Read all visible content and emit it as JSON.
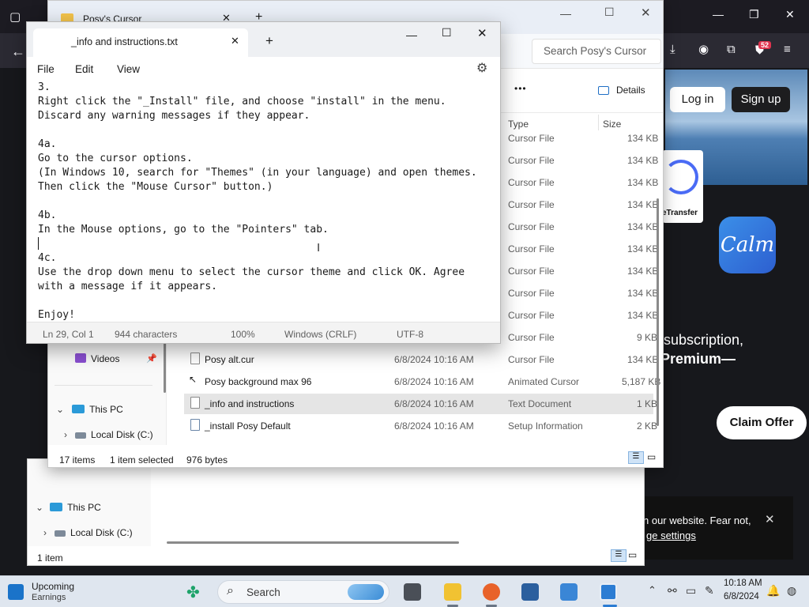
{
  "browser": {
    "explorer_tab_title": "Posy's Cursor",
    "new_tab": "+",
    "notif_count": "52",
    "login": "Log in",
    "signup": "Sign up",
    "wetransfer": "eTransfer",
    "calm": "Calm",
    "promo_line1": "subscription,",
    "promo_line2": "Premium—",
    "claim": "Claim Offer",
    "cookie_text": "n our website. Fear not,",
    "cookie_link": "ge settings",
    "cookie_close": "✕"
  },
  "explorer": {
    "search_placeholder": "Search Posy's Cursor",
    "more": "•••",
    "details": "Details",
    "columns": {
      "type": "Type",
      "size": "Size"
    },
    "upper_rows": [
      {
        "type": "Cursor File",
        "size": "134 KB"
      },
      {
        "type": "Cursor File",
        "size": "134 KB"
      },
      {
        "type": "Cursor File",
        "size": "134 KB"
      },
      {
        "type": "Cursor File",
        "size": "134 KB"
      },
      {
        "type": "Cursor File",
        "size": "134 KB"
      },
      {
        "type": "Cursor File",
        "size": "134 KB"
      },
      {
        "type": "Cursor File",
        "size": "134 KB"
      },
      {
        "type": "Cursor File",
        "size": "134 KB"
      },
      {
        "type": "Cursor File",
        "size": "134 KB"
      },
      {
        "type": "Cursor File",
        "size": "9 KB"
      }
    ],
    "files": [
      {
        "name": "Posy alt.cur",
        "date": "6/8/2024 10:16 AM",
        "type": "Cursor File",
        "size": "134 KB"
      },
      {
        "name": "Posy background max 96",
        "date": "6/8/2024 10:16 AM",
        "type": "Animated Cursor",
        "size": "5,187 KB"
      },
      {
        "name": "_info and instructions",
        "date": "6/8/2024 10:16 AM",
        "type": "Text Document",
        "size": "1 KB"
      },
      {
        "name": "_install Posy Default",
        "date": "6/8/2024 10:16 AM",
        "type": "Setup Information",
        "size": "2 KB"
      }
    ],
    "nav": {
      "videos": "Videos",
      "this_pc": "This PC",
      "local_disk": "Local Disk (C:)"
    },
    "status": {
      "count": "17 items",
      "selected": "1 item selected",
      "bytes": "976 bytes"
    }
  },
  "explorer_back": {
    "this_pc": "This PC",
    "local_disk": "Local Disk (C:)",
    "status": "1 item"
  },
  "notepad": {
    "tab_title": "_info and instructions.txt",
    "menu": {
      "file": "File",
      "edit": "Edit",
      "view": "View"
    },
    "content": "3.\nRight click the \"_Install\" file, and choose \"install\" in the menu.\nDiscard any warning messages if they appear.\n\n4a.\nGo to the cursor options.\n(In Windows 10, search for \"Themes\" (in your language) and open themes.\nThen click the \"Mouse Cursor\" button.)\n\n4b.\nIn the Mouse options, go to the \"Pointers\" tab.\n\n4c.\nUse the drop down menu to select the cursor theme and click OK. Agree\nwith a message if it appears.\n\nEnjoy!",
    "status": {
      "position": "Ln 29, Col 1",
      "chars": "944 characters",
      "zoom": "100%",
      "eol": "Windows (CRLF)",
      "encoding": "UTF-8"
    }
  },
  "taskbar": {
    "weather_title": "Upcoming",
    "weather_sub": "Earnings",
    "search": "Search",
    "time": "10:18 AM",
    "date": "6/8/2024"
  }
}
